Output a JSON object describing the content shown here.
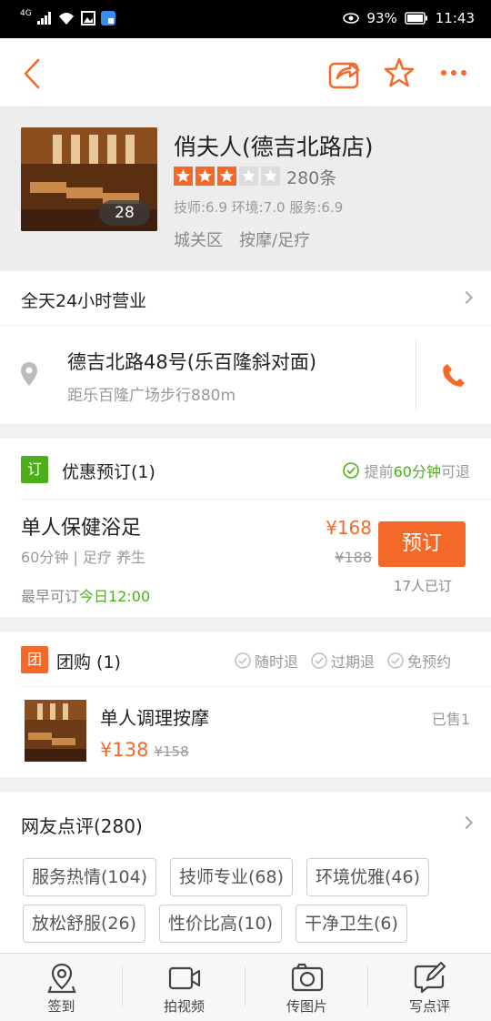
{
  "status_bar": {
    "network": "4G",
    "battery": "93%",
    "time": "11:43"
  },
  "shop": {
    "name": "俏夫人(德吉北路店)",
    "photo_count": "28",
    "rating_stars": 3,
    "review_count": "280条",
    "scores": "技师:6.9 环境:7.0 服务:6.9",
    "district": "城关区",
    "category": "按摩/足疗"
  },
  "hours": "全天24小时营业",
  "address": {
    "line1": "德吉北路48号(乐百隆斜对面)",
    "line2": "距乐百隆广场步行880m"
  },
  "booking": {
    "tag": "订",
    "title": "优惠预订(1)",
    "refund_pre": "提前",
    "refund_highlight": "60分钟",
    "refund_post": "可退",
    "item_name": "单人保健浴足",
    "item_meta": "60分钟 | 足疗 养生",
    "price": "¥168",
    "orig_price": "¥188",
    "button": "预订",
    "booked": "17人已订",
    "earliest_pre": "最早可订",
    "earliest_time": "今日12:00"
  },
  "group": {
    "tag": "团",
    "title": "团购 (1)",
    "features": [
      "随时退",
      "过期退",
      "免预约"
    ],
    "item_name": "单人调理按摩",
    "price": "¥138",
    "orig_price": "¥158",
    "sold": "已售1"
  },
  "reviews": {
    "title": "网友点评(280)",
    "chips": [
      "服务热情(104)",
      "技师专业(68)",
      "环境优雅(46)",
      "放松舒服(26)",
      "性价比高(10)",
      "干净卫生(6)"
    ]
  },
  "tabbar": [
    "签到",
    "拍视频",
    "传图片",
    "写点评"
  ],
  "colors": {
    "accent": "#f4692a",
    "green": "#4caf1a",
    "star": "#f4692a"
  }
}
